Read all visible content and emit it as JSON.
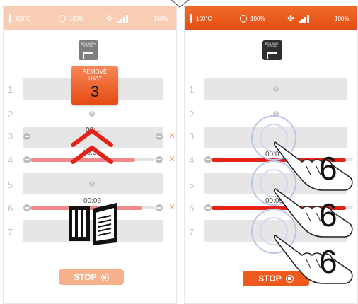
{
  "status_bar": {
    "temperature": "100°C",
    "humidity": "100%",
    "fan_speed": "100%"
  },
  "program": {
    "label_line1": "BOIL WITH",
    "label_line2": "STEAM"
  },
  "left_panel": {
    "alert": {
      "title_line1": "REMOVE",
      "title_line2": "TRAY",
      "tray_number": "3"
    },
    "rows": [
      "1",
      "2",
      "3",
      "4",
      "5",
      "6",
      "7"
    ],
    "timers": {
      "row3": "00:...",
      "row4": "00:0...",
      "row6": "00:09"
    },
    "row_progress": {
      "row4": 0.84,
      "row6": 0.9
    }
  },
  "right_panel": {
    "rows": [
      "1",
      "2",
      "3",
      "4",
      "5",
      "6",
      "7"
    ],
    "timers": {
      "row4": "00:0...",
      "row6": "00:09"
    },
    "row_progress": {
      "row4": 0.95,
      "row6": 0.95
    },
    "gesture_count": "6"
  },
  "controls": {
    "stop_label": "STOP"
  },
  "colors": {
    "accent": "#ef5a1c",
    "accent_light": "#f5ad8a",
    "progress_red": "#e52218",
    "progress_pink": "#f1888a"
  },
  "icons": [
    "thermometer-icon",
    "droplet-icon",
    "fan-icon",
    "signal-icon",
    "pot-icon",
    "plus-icon",
    "close-icon",
    "stop-icon",
    "chevron-up-icon",
    "oven-door-icon",
    "hand-pointer-icon"
  ]
}
